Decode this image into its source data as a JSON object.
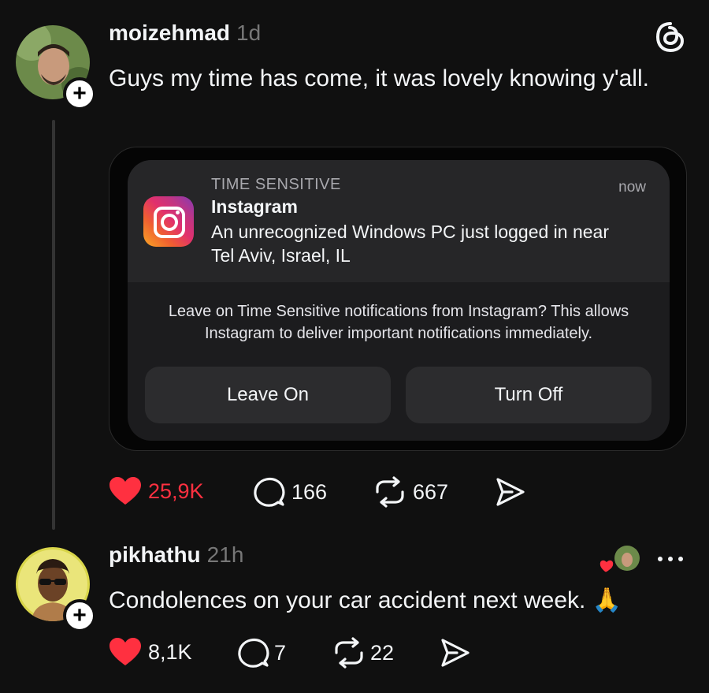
{
  "post": {
    "username": "moizehmad",
    "time": "1d",
    "text": "Guys my time has come, it was lovely knowing y'all.",
    "notification": {
      "category": "TIME SENSITIVE",
      "time": "now",
      "app": "Instagram",
      "message": "An unrecognized Windows PC just logged in near Tel Aviv, Israel, IL",
      "prompt": "Leave on Time Sensitive notifications from Instagram? This allows Instagram to deliver important notifications immediately.",
      "leave_on_label": "Leave On",
      "turn_off_label": "Turn Off"
    },
    "likes": "25,9K",
    "replies": "166",
    "reposts": "667"
  },
  "reply": {
    "username": "pikhathu",
    "time": "21h",
    "text": "Condolences on your car accident next week.",
    "emoji": "🙏",
    "likes": "8,1K",
    "replies": "7",
    "reposts": "22"
  },
  "icons": {
    "app_logo": "threads-logo-icon",
    "like": "heart-icon",
    "reply": "comment-icon",
    "repost": "repost-icon",
    "share": "send-icon",
    "more": "more-icon"
  },
  "colors": {
    "background": "#101010",
    "like_active": "#ff3040",
    "text_primary": "#f3f5f7",
    "text_secondary": "#777777"
  }
}
